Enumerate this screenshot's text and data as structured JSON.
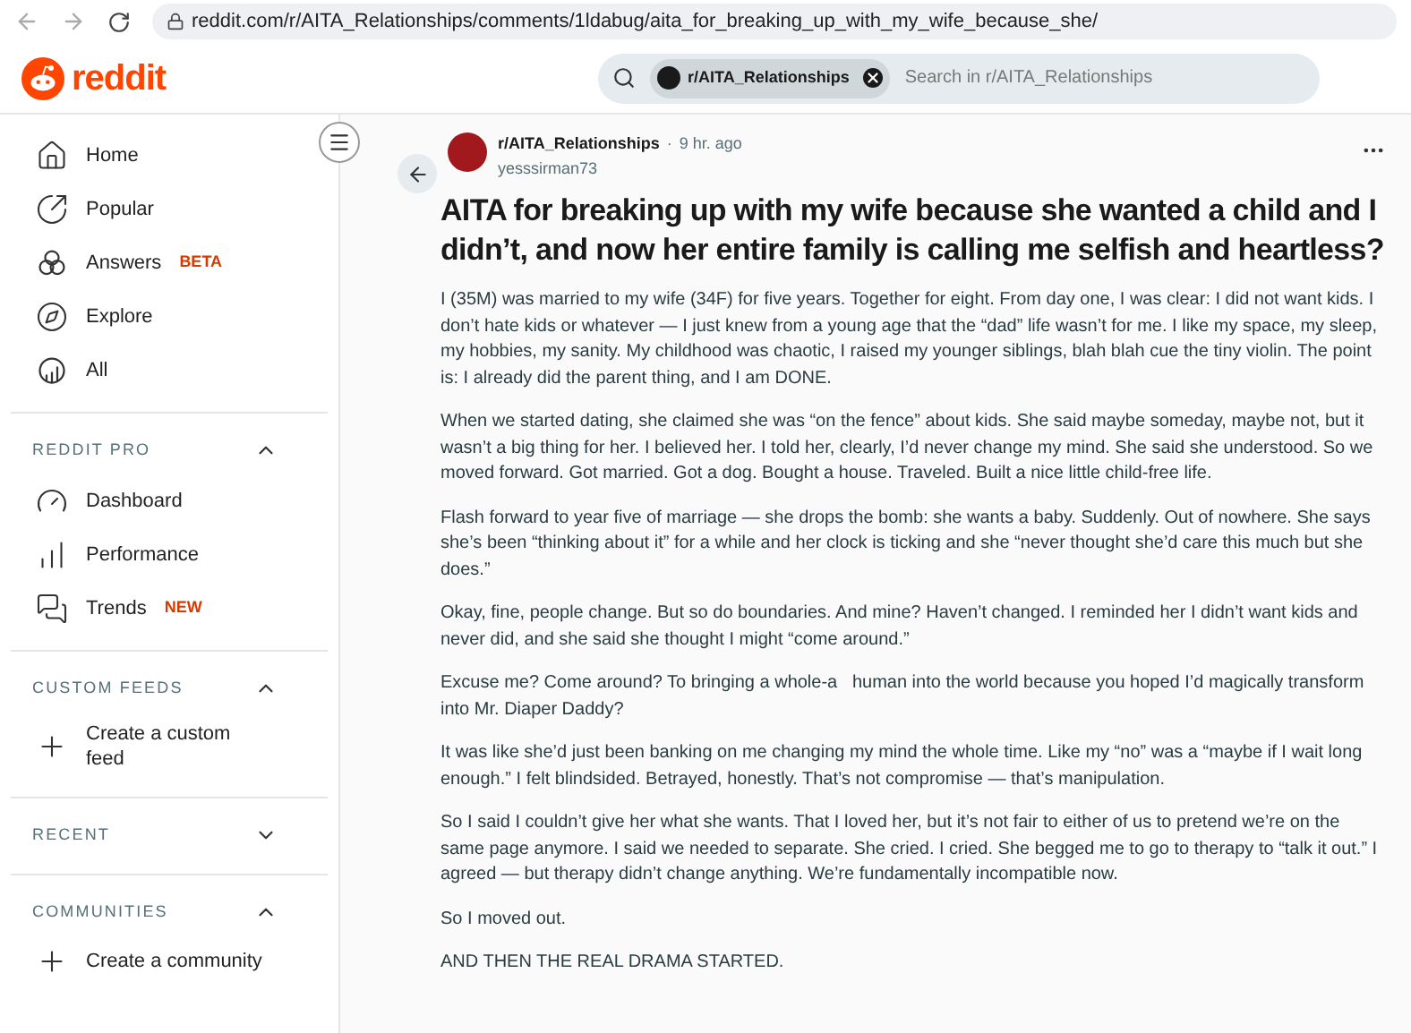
{
  "browser": {
    "url": "reddit.com/r/AITA_Relationships/comments/1ldabug/aita_for_breaking_up_with_my_wife_because_she/"
  },
  "header": {
    "logo_text": "reddit",
    "search": {
      "chip": "r/AITA_Relationships",
      "placeholder": "Search in r/AITA_Relationships"
    }
  },
  "sidebar": {
    "nav": [
      {
        "kind": "home",
        "label": "Home"
      },
      {
        "kind": "popular",
        "label": "Popular"
      },
      {
        "kind": "answers",
        "label": "Answers",
        "badge": "BETA"
      },
      {
        "kind": "explore",
        "label": "Explore"
      },
      {
        "kind": "all",
        "label": "All"
      }
    ],
    "sections": [
      {
        "title": "REDDIT PRO",
        "expanded": true,
        "items": [
          {
            "kind": "dashboard",
            "label": "Dashboard"
          },
          {
            "kind": "performance",
            "label": "Performance"
          },
          {
            "kind": "trends",
            "label": "Trends",
            "badge": "NEW"
          }
        ]
      },
      {
        "title": "CUSTOM FEEDS",
        "expanded": true,
        "items": [
          {
            "kind": "plus",
            "label": "Create a custom feed"
          }
        ]
      },
      {
        "title": "RECENT",
        "expanded": false
      },
      {
        "title": "COMMUNITIES",
        "expanded": true,
        "items": [
          {
            "kind": "plus",
            "label": "Create a community"
          }
        ]
      }
    ]
  },
  "post": {
    "subreddit": "r/AITA_Relationships",
    "separator": "·",
    "time": "9 hr. ago",
    "author": "yesssirman73",
    "title": "AITA for breaking up with my wife because she wanted a child and I didn’t, and now her entire family is calling me selfish and heartless?",
    "paragraphs": [
      "I (35M) was married to my wife (34F) for five years. Together for eight. From day one, I was clear: I did not want kids. I don’t hate kids or whatever — I just knew from a young age that the “dad” life wasn’t for me. I like my space, my sleep, my hobbies, my sanity. My childhood was chaotic, I raised my younger siblings, blah blah cue the tiny violin. The point is: I already did the parent thing, and I am DONE.",
      "When we started dating, she claimed she was “on the fence” about kids. She said maybe someday, maybe not, but it wasn’t a big thing for her. I believed her. I told her, clearly, I’d never change my mind. She said she understood. So we moved forward. Got married. Got a dog. Bought a house. Traveled. Built a nice little child-free life.",
      "Flash forward to year five of marriage — she drops the bomb: she wants a baby. Suddenly. Out of nowhere. She says she’s been “thinking about it” for a while and her clock is ticking and she “never thought she’d care this much but she does.”",
      "Okay, fine, people change. But so do boundaries. And mine? Haven’t changed. I reminded her I didn’t want kids and never did, and she said she thought I might “come around.”",
      "Excuse me? Come around? To bringing a whole-a   human into the world because you hoped I’d magically transform into Mr. Diaper Daddy?",
      "It was like she’d just been banking on me changing my mind the whole time. Like my “no” was a “maybe if I wait long enough.” I felt blindsided. Betrayed, honestly. That’s not compromise — that’s manipulation.",
      "So I said I couldn’t give her what she wants. That I loved her, but it’s not fair to either of us to pretend we’re on the same page anymore. I said we needed to separate. She cried. I cried. She begged me to go to therapy to “talk it out.” I agreed — but therapy didn’t change anything. We’re fundamentally incompatible now.",
      "So I moved out.",
      "AND THEN THE REAL DRAMA STARTED."
    ]
  }
}
